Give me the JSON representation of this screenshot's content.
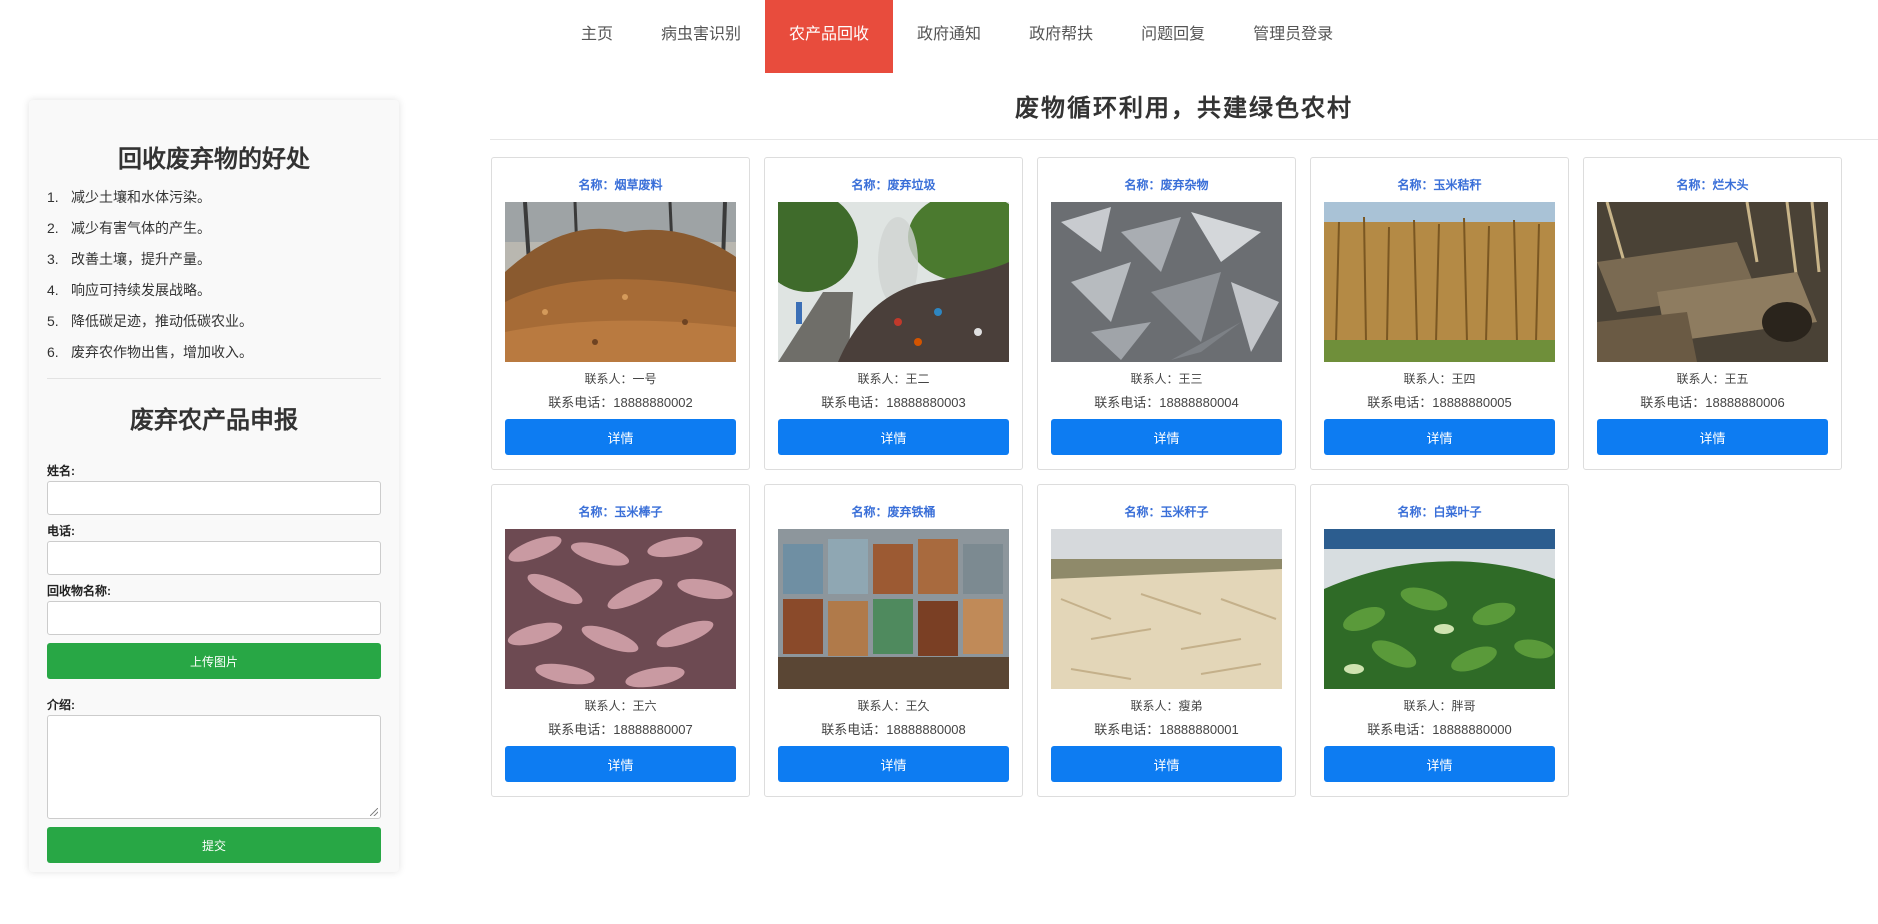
{
  "nav": {
    "items": [
      "主页",
      "病虫害识别",
      "农产品回收",
      "政府通知",
      "政府帮扶",
      "问题回复",
      "管理员登录"
    ],
    "active_index": 2
  },
  "sidebar": {
    "benefits_title": "回收废弃物的好处",
    "benefits": [
      {
        "num": "1.",
        "text": "减少土壤和水体污染。"
      },
      {
        "num": "2.",
        "text": "减少有害气体的产生。"
      },
      {
        "num": "3.",
        "text": "改善土壤，提升产量。"
      },
      {
        "num": "4.",
        "text": "响应可持续发展战略。"
      },
      {
        "num": "5.",
        "text": "降低碳足迹，推动低碳农业。"
      },
      {
        "num": "6.",
        "text": "废弃农作物出售，增加收入。"
      }
    ],
    "report_title": "废弃农产品申报",
    "form": {
      "name_label": "姓名:",
      "phone_label": "电话:",
      "item_label": "回收物名称:",
      "upload_button": "上传图片",
      "intro_label": "介绍:",
      "submit_button": "提交"
    }
  },
  "main": {
    "title": "废物循环利用，共建绿色农村",
    "detail_label": "详情",
    "contact_prefix": "联系人：",
    "phone_prefix": "联系电话：",
    "cards": [
      {
        "name": "名称：烟草废料",
        "contact": "一号",
        "phone": "18888880002",
        "image": "tobacco-waste-pile"
      },
      {
        "name": "名称：废弃垃圾",
        "contact": "王二",
        "phone": "18888880003",
        "image": "roadside-garbage"
      },
      {
        "name": "名称：废弃杂物",
        "contact": "王三",
        "phone": "18888880004",
        "image": "scrap-metal"
      },
      {
        "name": "名称：玉米秸秆",
        "contact": "王四",
        "phone": "18888880005",
        "image": "corn-stalks"
      },
      {
        "name": "名称：烂木头",
        "contact": "王五",
        "phone": "18888880006",
        "image": "rotten-wood"
      },
      {
        "name": "名称：玉米棒子",
        "contact": "王六",
        "phone": "18888880007",
        "image": "corn-cobs"
      },
      {
        "name": "名称：废弃铁桶",
        "contact": "王久",
        "phone": "18888880008",
        "image": "rusty-barrels"
      },
      {
        "name": "名称：玉米秆子",
        "contact": "瘦弟",
        "phone": "18888880001",
        "image": "corn-husks-field"
      },
      {
        "name": "名称：白菜叶子",
        "contact": "胖哥",
        "phone": "18888880000",
        "image": "cabbage-leaves"
      }
    ]
  },
  "colors": {
    "nav_active": "#e84c3d",
    "detail_button": "#0d7cf2",
    "green_button": "#28a745",
    "card_name": "#3a6fd8"
  }
}
